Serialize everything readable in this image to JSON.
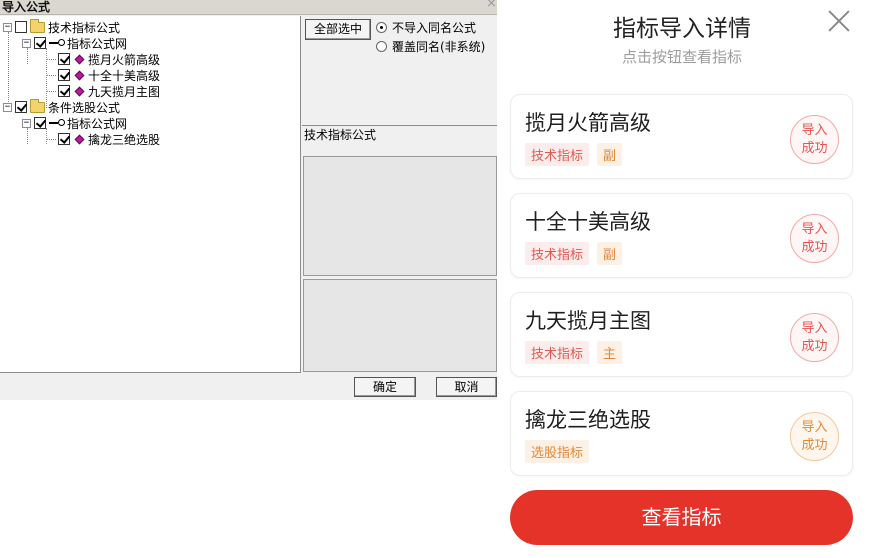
{
  "dialog": {
    "title": "导入公式",
    "close_glyph": "×",
    "tree": [
      {
        "id": "tech",
        "label": "技术指标公式",
        "expander": "−",
        "checked": false
      },
      {
        "id": "tech_net",
        "label": "指标公式网",
        "expander": "−",
        "checked": true
      },
      {
        "id": "tech_f1",
        "label": "揽月火箭高级",
        "checked": true
      },
      {
        "id": "tech_f2",
        "label": "十全十美高级",
        "checked": true
      },
      {
        "id": "tech_f3",
        "label": "九天揽月主图",
        "checked": true
      },
      {
        "id": "cond",
        "label": "条件选股公式",
        "expander": "−",
        "checked": true
      },
      {
        "id": "cond_net",
        "label": "指标公式网",
        "expander": "−",
        "checked": true
      },
      {
        "id": "cond_f1",
        "label": "擒龙三绝选股",
        "checked": true
      }
    ],
    "select_all_label": "全部选中",
    "radio_options": [
      {
        "label": "不导入同名公式",
        "selected": true
      },
      {
        "label": "覆盖同名(非系统)",
        "selected": false
      }
    ],
    "info_label": "技术指标公式",
    "ok_label": "确定",
    "cancel_label": "取消"
  },
  "sheet": {
    "title": "指标导入详情",
    "subtitle": "点击按钮查看指标",
    "items": [
      {
        "title": "揽月火箭高级",
        "tags": [
          {
            "text": "技术指标",
            "tone": "red"
          },
          {
            "text": "副",
            "tone": "orange"
          }
        ],
        "badge_line1": "导入",
        "badge_line2": "成功",
        "badge_tone": "red"
      },
      {
        "title": "十全十美高级",
        "tags": [
          {
            "text": "技术指标",
            "tone": "red"
          },
          {
            "text": "副",
            "tone": "orange"
          }
        ],
        "badge_line1": "导入",
        "badge_line2": "成功",
        "badge_tone": "red"
      },
      {
        "title": "九天揽月主图",
        "tags": [
          {
            "text": "技术指标",
            "tone": "red"
          },
          {
            "text": "主",
            "tone": "orange"
          }
        ],
        "badge_line1": "导入",
        "badge_line2": "成功",
        "badge_tone": "red"
      },
      {
        "title": "擒龙三绝选股",
        "tags": [
          {
            "text": "选股指标",
            "tone": "orange"
          }
        ],
        "badge_line1": "导入",
        "badge_line2": "成功",
        "badge_tone": "orange"
      }
    ],
    "cta_label": "查看指标"
  },
  "colors": {
    "accent": "#e6332a",
    "tag_red": "#e05a4d",
    "tag_orange": "#e2883a",
    "folder": "#f3d36c",
    "formula_gem": "#c1169b"
  }
}
